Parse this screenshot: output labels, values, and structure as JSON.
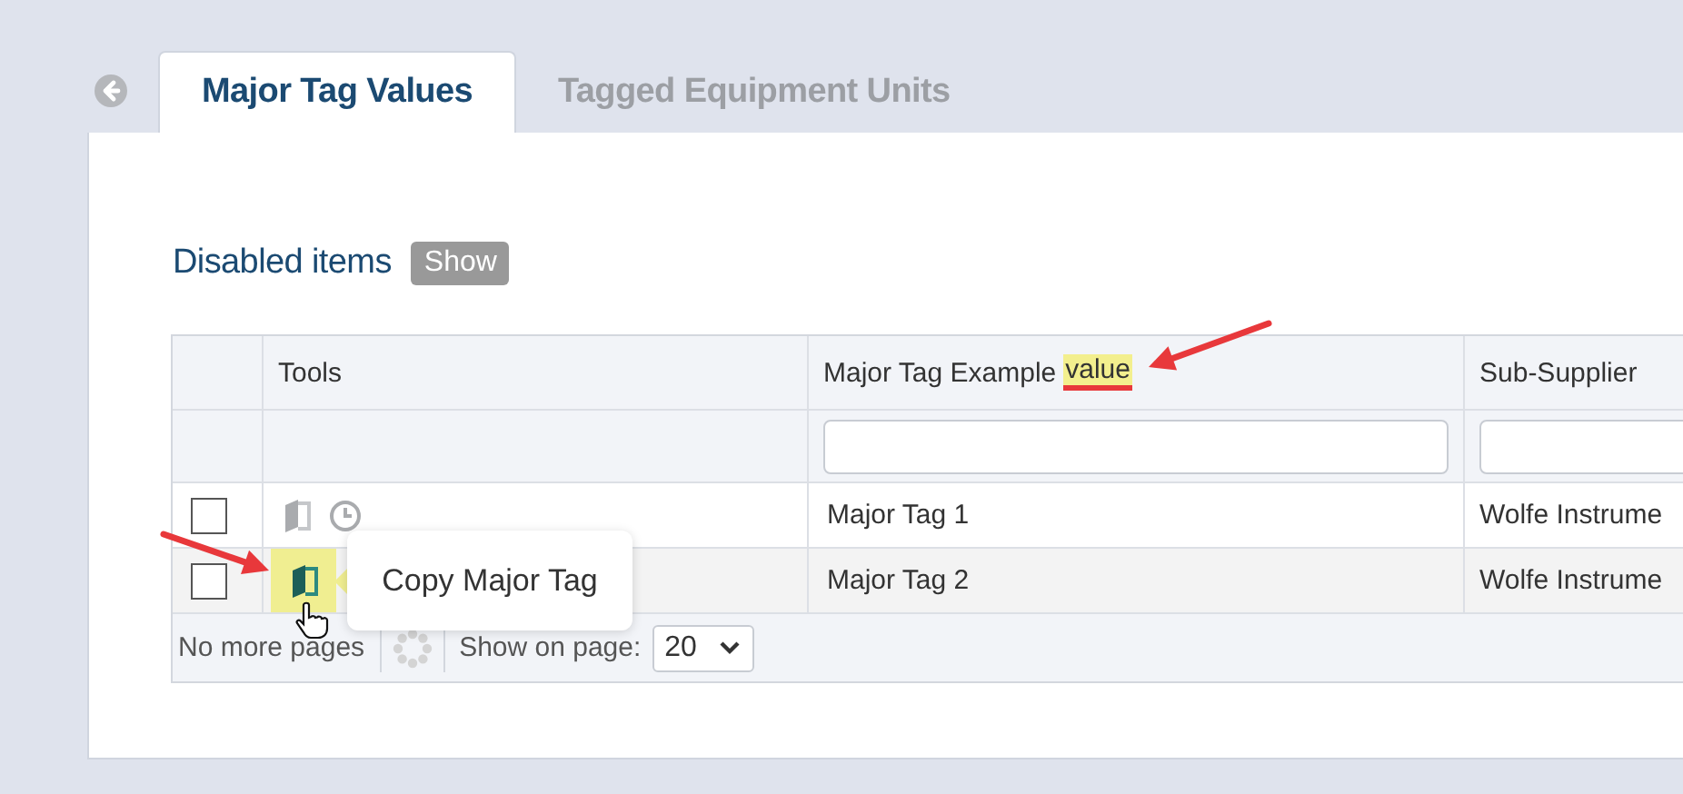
{
  "tabs": [
    {
      "label": "Major Tag Values",
      "selected": true
    },
    {
      "label": "Tagged Equipment Units",
      "selected": false
    }
  ],
  "disabled_items": {
    "label": "Disabled items",
    "button": "Show"
  },
  "table": {
    "columns": [
      {
        "kind": "checkbox"
      },
      {
        "kind": "tools",
        "label": "Tools"
      },
      {
        "kind": "text",
        "label": "Major Tag Example",
        "highlight": "value"
      },
      {
        "kind": "text",
        "label": "Sub-Supplier"
      }
    ],
    "rows": [
      {
        "checked": false,
        "hovered": false,
        "tools": [
          {
            "kind": "copy"
          },
          {
            "kind": "history"
          }
        ],
        "major_tag": "Major Tag 1",
        "sub_supplier": "Wolfe Instrume"
      },
      {
        "checked": false,
        "hovered": true,
        "tools": [
          {
            "kind": "copy"
          }
        ],
        "major_tag": "Major Tag 2",
        "sub_supplier": "Wolfe Instrume"
      }
    ],
    "footer": {
      "status": "No more pages",
      "page_size_label": "Show on page:",
      "page_size": "20"
    }
  },
  "tooltip": {
    "text": "Copy Major Tag"
  }
}
